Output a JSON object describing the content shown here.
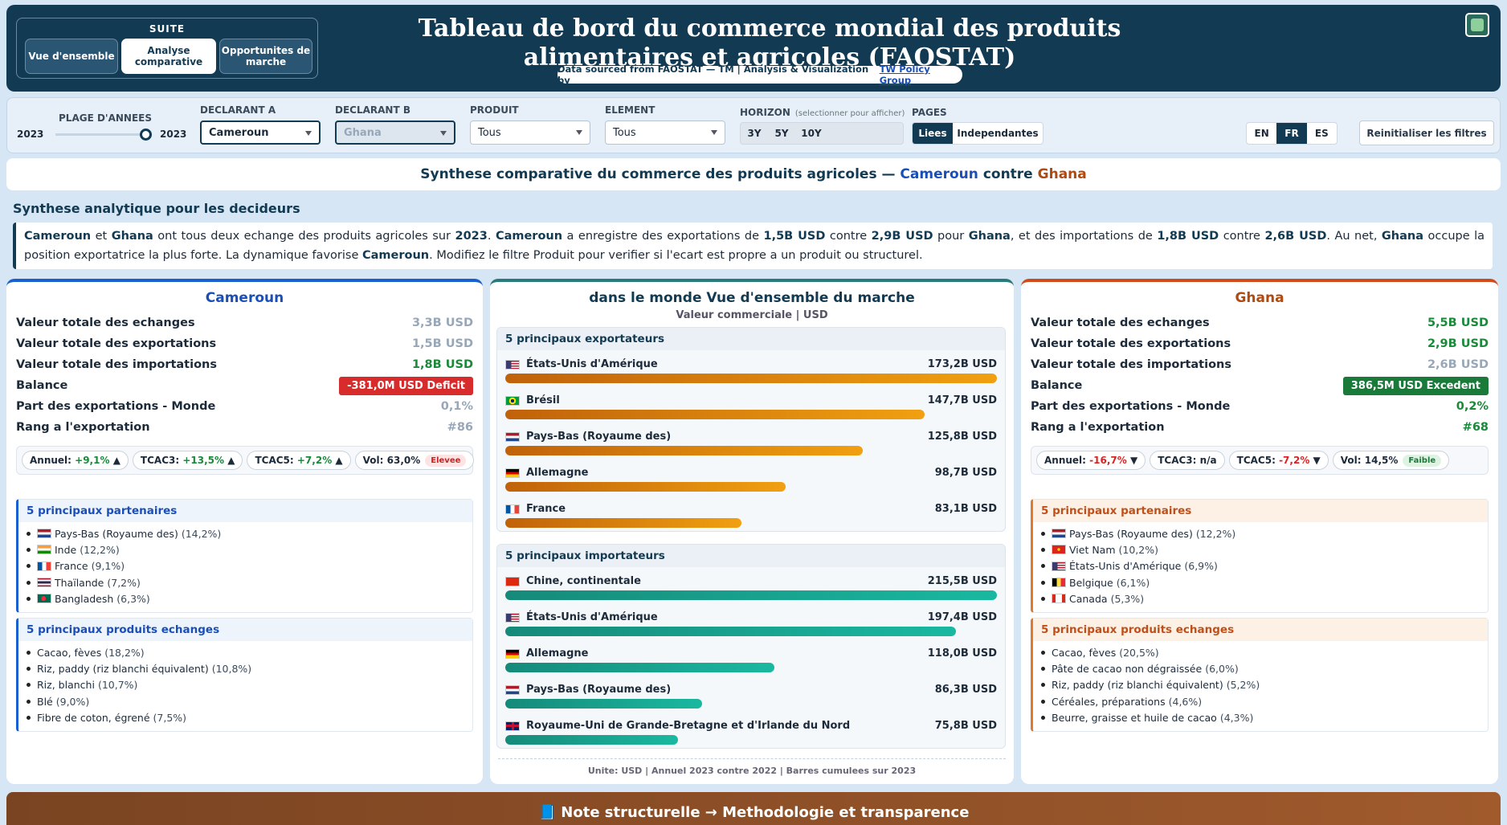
{
  "header": {
    "suite_title": "SUITE",
    "suite_buttons": [
      "Vue d'ensemble",
      "Analyse comparative",
      "Opportunites de marche"
    ],
    "title": "Tableau de bord du commerce mondial des produits alimentaires et agricoles (FAOSTAT)",
    "source_text": "Data sourced from FAOSTAT — TM | Analysis & Visualization by",
    "source_link": "TW Policy Group",
    "logo_icon": "tw-logo"
  },
  "filters": {
    "years_label": "PLAGE D'ANNEES",
    "year_from": "2023",
    "year_to": "2023",
    "reporter_a_label": "DECLARANT A",
    "reporter_a": "Cameroun",
    "reporter_b_label": "DECLARANT B",
    "reporter_b": "Ghana",
    "product_label": "PRODUIT",
    "product": "Tous",
    "element_label": "ELEMENT",
    "element": "Tous",
    "horizon_label": "HORIZON",
    "horizon_hint": "(selectionner pour afficher)",
    "horizons": [
      "3Y",
      "5Y",
      "10Y"
    ],
    "pages_label": "PAGES",
    "pages": [
      "Liees",
      "Independantes"
    ],
    "languages": [
      "EN",
      "FR",
      "ES"
    ],
    "reset_label": "Reinitialiser les filtres"
  },
  "synthesis": {
    "prefix": "Synthese comparative du commerce des produits agricoles —",
    "a": "Cameroun",
    "mid": "contre",
    "b": "Ghana"
  },
  "executive": {
    "title": "Synthese analytique pour les decideurs",
    "t1": "Cameroun",
    "t2": " et ",
    "t3": "Ghana",
    "t4": " ont tous deux echange des produits agricoles sur ",
    "t5": "2023",
    "t6": ". ",
    "t7": "Cameroun",
    "t8": " a enregistre des exportations de ",
    "t9": "1,5B USD",
    "t10": " contre ",
    "t11": "2,9B USD",
    "t12": " pour ",
    "t13": "Ghana",
    "t14": ", et des importations de ",
    "t15": "1,8B USD",
    "t16": " contre ",
    "t17": "2,6B USD",
    "t18": ". Au net, ",
    "t19": "Ghana",
    "t20": " occupe la position exportatrice la plus forte. La dynamique favorise ",
    "t21": "Cameroun",
    "t22": ". Modifiez le filtre Produit pour verifier si l'ecart est propre a un produit ou structurel."
  },
  "cameroun": {
    "title": "Cameroun",
    "kpis": [
      {
        "label": "Valeur totale des echanges",
        "value": "3,3B USD"
      },
      {
        "label": "Valeur totale des exportations",
        "value": "1,5B USD"
      },
      {
        "label": "Valeur totale des importations",
        "value": "1,8B USD"
      },
      {
        "label": "Balance",
        "value": "-381,0M USD Deficit"
      },
      {
        "label": "Part des exportations - Monde",
        "value": "0,1%"
      },
      {
        "label": "Rang a l'exportation",
        "value": "#86"
      }
    ],
    "pills": {
      "annual_label": "Annuel:",
      "annual": "+9,1%",
      "cagr3_label": "TCAC3:",
      "cagr3": "+13,5%",
      "cagr5_label": "TCAC5:",
      "cagr5": "+7,2%",
      "vol_label": "Vol:",
      "vol": "63,0%",
      "vol_tag": "Elevee"
    },
    "partners_title": "5 principaux partenaires",
    "partners": [
      {
        "name": "Pays-Bas (Royaume des)",
        "share": "(14,2%)",
        "flag": "NL"
      },
      {
        "name": "Inde",
        "share": "(12,2%)",
        "flag": "IN"
      },
      {
        "name": "France",
        "share": "(9,1%)",
        "flag": "FR"
      },
      {
        "name": "Thaïlande",
        "share": "(7,2%)",
        "flag": "TH"
      },
      {
        "name": "Bangladesh",
        "share": "(6,3%)",
        "flag": "BD"
      }
    ],
    "products_title": "5 principaux produits echanges",
    "products": [
      {
        "name": "Cacao, fèves",
        "share": "(18,2%)"
      },
      {
        "name": "Riz, paddy (riz blanchi équivalent)",
        "share": "(10,8%)"
      },
      {
        "name": "Riz, blanchi",
        "share": "(10,7%)"
      },
      {
        "name": "Blé",
        "share": "(9,0%)"
      },
      {
        "name": "Fibre de coton, égrené",
        "share": "(7,5%)"
      }
    ]
  },
  "world": {
    "title": "dans le monde Vue d'ensemble du marche",
    "subtitle": "Valeur commerciale | USD",
    "exporters_title": "5 principaux exportateurs",
    "exporters": [
      {
        "name": "États-Unis d'Amérique",
        "value": "173,2B USD",
        "amount": 173.2,
        "flag": "US"
      },
      {
        "name": "Brésil",
        "value": "147,7B USD",
        "amount": 147.7,
        "flag": "BR"
      },
      {
        "name": "Pays-Bas (Royaume des)",
        "value": "125,8B USD",
        "amount": 125.8,
        "flag": "NL"
      },
      {
        "name": "Allemagne",
        "value": "98,7B USD",
        "amount": 98.7,
        "flag": "DE"
      },
      {
        "name": "France",
        "value": "83,1B USD",
        "amount": 83.1,
        "flag": "FR"
      }
    ],
    "importers_title": "5 principaux importateurs",
    "importers": [
      {
        "name": "Chine, continentale",
        "value": "215,5B USD",
        "amount": 215.5,
        "flag": "CN"
      },
      {
        "name": "États-Unis d'Amérique",
        "value": "197,4B USD",
        "amount": 197.4,
        "flag": "US"
      },
      {
        "name": "Allemagne",
        "value": "118,0B USD",
        "amount": 118.0,
        "flag": "DE"
      },
      {
        "name": "Pays-Bas (Royaume des)",
        "value": "86,3B USD",
        "amount": 86.3,
        "flag": "NL"
      },
      {
        "name": "Royaume-Uni de Grande-Bretagne et d'Irlande du Nord",
        "value": "75,8B USD",
        "amount": 75.8,
        "flag": "GB"
      }
    ],
    "footer": "Unite: USD | Annuel 2023 contre 2022 | Barres cumulees sur 2023"
  },
  "ghana": {
    "title": "Ghana",
    "kpis": [
      {
        "label": "Valeur totale des echanges",
        "value": "5,5B USD"
      },
      {
        "label": "Valeur totale des exportations",
        "value": "2,9B USD"
      },
      {
        "label": "Valeur totale des importations",
        "value": "2,6B USD"
      },
      {
        "label": "Balance",
        "value": "386,5M USD Excedent"
      },
      {
        "label": "Part des exportations - Monde",
        "value": "0,2%"
      },
      {
        "label": "Rang a l'exportation",
        "value": "#68"
      }
    ],
    "pills": {
      "annual_label": "Annuel:",
      "annual": "-16,7%",
      "cagr3_label": "TCAC3:",
      "cagr3": "n/a",
      "cagr5_label": "TCAC5:",
      "cagr5": "-7,2%",
      "vol_label": "Vol:",
      "vol": "14,5%",
      "vol_tag": "Faible"
    },
    "partners_title": "5 principaux partenaires",
    "partners": [
      {
        "name": "Pays-Bas (Royaume des)",
        "share": "(12,2%)",
        "flag": "NL"
      },
      {
        "name": "Viet Nam",
        "share": "(10,2%)",
        "flag": "VN"
      },
      {
        "name": "États-Unis d'Amérique",
        "share": "(6,9%)",
        "flag": "US"
      },
      {
        "name": "Belgique",
        "share": "(6,1%)",
        "flag": "BE"
      },
      {
        "name": "Canada",
        "share": "(5,3%)",
        "flag": "CA"
      }
    ],
    "products_title": "5 principaux produits echanges",
    "products": [
      {
        "name": "Cacao, fèves",
        "share": "(20,5%)"
      },
      {
        "name": "Pâte de cacao non dégraissée",
        "share": "(6,0%)"
      },
      {
        "name": "Riz, paddy (riz blanchi équivalent)",
        "share": "(5,2%)"
      },
      {
        "name": "Céréales, préparations",
        "share": "(4,6%)"
      },
      {
        "name": "Beurre, graisse et huile de cacao",
        "share": "(4,3%)"
      }
    ]
  },
  "note": {
    "icon": "book-icon",
    "text": "Note structurelle → Methodologie et transparence"
  },
  "colors": {
    "header_bg": "#123a52",
    "cameroun": "#1a4fb8",
    "ghana": "#b04a10",
    "positive": "#1a8a3a",
    "negative": "#d22222"
  }
}
